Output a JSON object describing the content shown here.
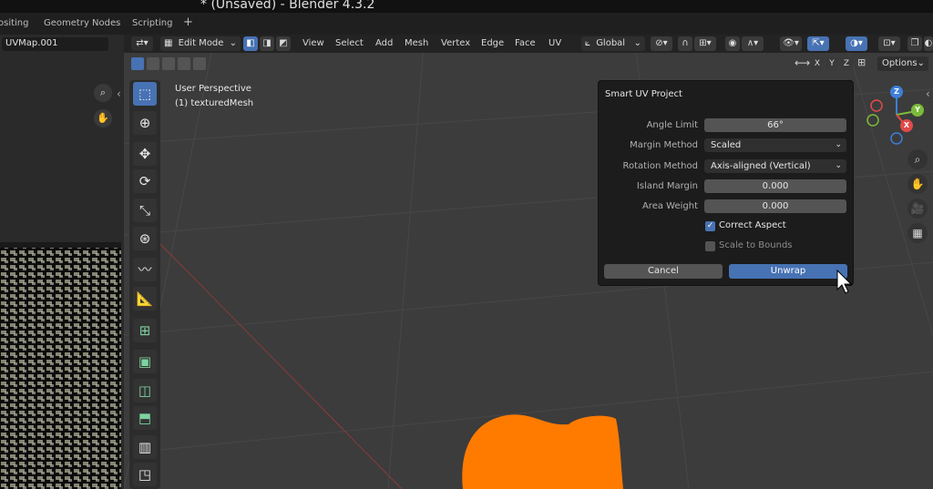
{
  "window": {
    "title": "* (Unsaved) - Blender 4.3.2"
  },
  "workspace_tabs": [
    "ositing",
    "Geometry Nodes",
    "Scripting",
    "+"
  ],
  "uv_panel": {
    "uv_map_name": "UVMap.001"
  },
  "header": {
    "mode": "Edit Mode",
    "menus": [
      "View",
      "Select",
      "Add",
      "Mesh",
      "Vertex",
      "Edge",
      "Face",
      "UV"
    ],
    "orientation": "Global"
  },
  "header2": {
    "axis_x": "X",
    "axis_y": "Y",
    "axis_z": "Z",
    "options": "Options"
  },
  "viewport": {
    "perspective": "User Perspective",
    "object": "(1) texturedMesh"
  },
  "dialog": {
    "title": "Smart UV Project",
    "angle_limit_label": "Angle Limit",
    "angle_limit_value": "66°",
    "margin_method_label": "Margin Method",
    "margin_method_value": "Scaled",
    "rotation_method_label": "Rotation Method",
    "rotation_method_value": "Axis-aligned (Vertical)",
    "island_margin_label": "Island Margin",
    "island_margin_value": "0.000",
    "area_weight_label": "Area Weight",
    "area_weight_value": "0.000",
    "correct_aspect_label": "Correct Aspect",
    "correct_aspect_checked": true,
    "scale_to_bounds_label": "Scale to Bounds",
    "scale_to_bounds_checked": false,
    "cancel_label": "Cancel",
    "unwrap_label": "Unwrap"
  },
  "gizmo": {
    "x": "X",
    "y": "Y",
    "z": "Z"
  },
  "colors": {
    "accent": "#4772b3",
    "axis_x": "#e04a4a",
    "axis_y": "#7cbb3a",
    "axis_z": "#3d7fd9",
    "orange_mesh": "#ff7b00"
  }
}
